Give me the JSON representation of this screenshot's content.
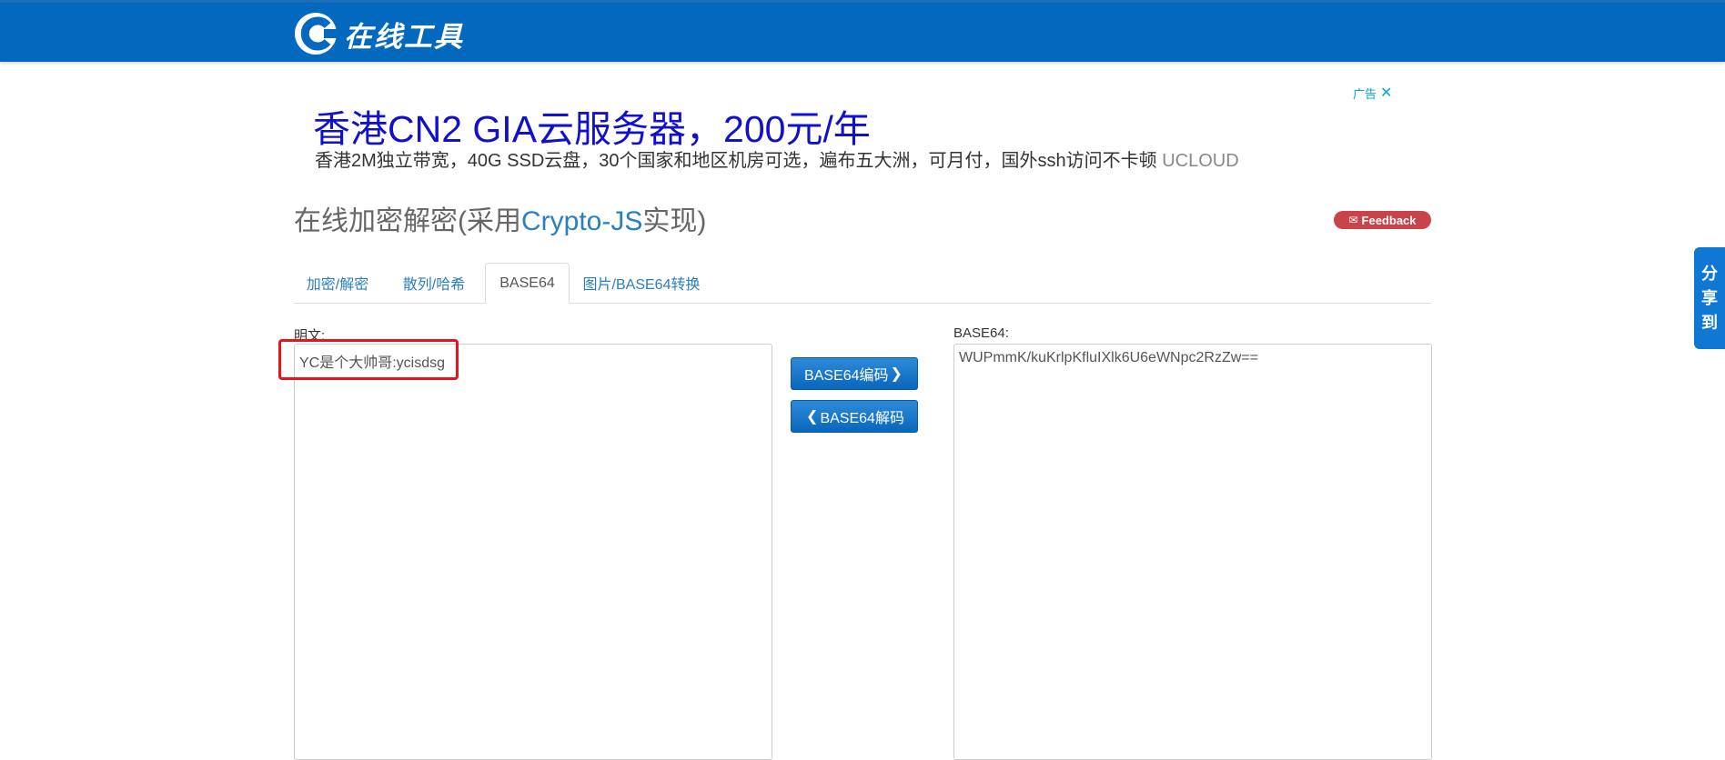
{
  "header": {
    "logo_text": "在线工具"
  },
  "ad": {
    "title": "香港CN2 GIA云服务器，200元/年",
    "description": "香港2M独立带宽，40G SSD云盘，30个国家和地区机房可选，遍布五大洲，可月付，国外ssh访问不卡顿",
    "brand": "UCLOUD",
    "label": "广告",
    "close_icon": "close-icon"
  },
  "page": {
    "title_prefix": "在线加密解密(采用",
    "title_accent": "Crypto-JS",
    "title_suffix": "实现)",
    "feedback_label": "Feedback"
  },
  "tabs": [
    {
      "label": "加密/解密",
      "active": false
    },
    {
      "label": "散列/哈希",
      "active": false
    },
    {
      "label": "BASE64",
      "active": true
    },
    {
      "label": "图片/BASE64转换",
      "active": false
    }
  ],
  "plaintext": {
    "label": "明文:",
    "value": "YC是个大帅哥:ycisdsg"
  },
  "base64": {
    "label": "BASE64:",
    "value": "WUPmmK/kuKrlpKfluIXlk6U6eWNpc2RzZw=="
  },
  "buttons": {
    "encode": "BASE64编码",
    "decode": "BASE64解码"
  },
  "share": {
    "chars": [
      "分",
      "享",
      "到"
    ]
  },
  "colors": {
    "header_bg": "#0269bf",
    "accent": "#2a7fc0",
    "ad_title": "#1111cc",
    "feedback_bg": "#c9434a",
    "highlight": "#e8141d"
  }
}
